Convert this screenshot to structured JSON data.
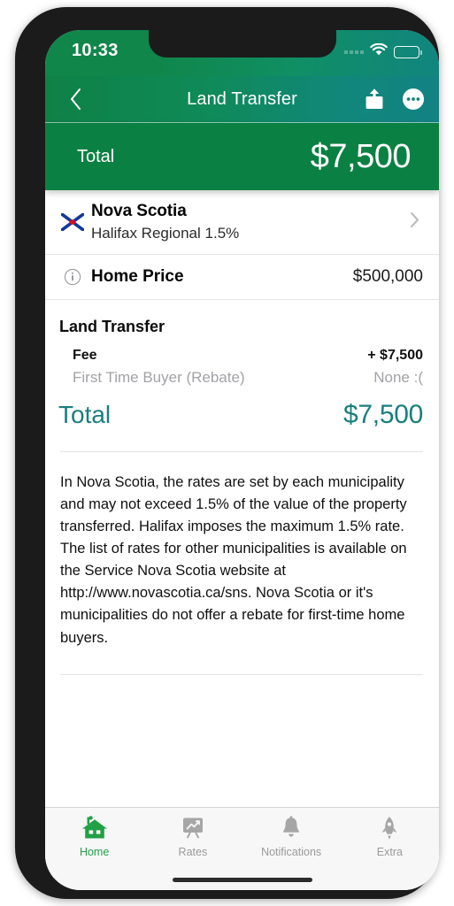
{
  "status_bar": {
    "time": "10:33",
    "wifi_icon": "wifi-icon",
    "battery_icon": "battery-full-icon"
  },
  "nav_bar": {
    "title": "Land Transfer",
    "back_icon": "chevron-left-icon",
    "share_icon": "share-icon",
    "more_icon": "more-circle-icon"
  },
  "total_banner": {
    "label": "Total",
    "value": "$7,500"
  },
  "region_row": {
    "flag_icon": "nova-scotia-flag-icon",
    "name": "Nova Scotia",
    "subtitle": "Halifax Regional 1.5%",
    "chevron_icon": "chevron-right-icon"
  },
  "home_price_row": {
    "info_icon": "info-circle-icon",
    "label": "Home Price",
    "value": "$500,000"
  },
  "land_transfer": {
    "section_title": "Land Transfer",
    "items": [
      {
        "label": "Fee",
        "value": "+ $7,500",
        "muted": false
      },
      {
        "label": "First Time Buyer (Rebate)",
        "value": "None :(",
        "muted": true
      }
    ],
    "total_label": "Total",
    "total_value": "$7,500"
  },
  "description": "In Nova Scotia, the rates are set by each municipality and may not exceed 1.5% of the value of the property transferred. Halifax imposes the maximum 1.5% rate. The list of rates for other municipalities is available on the Service Nova Scotia website at http://www.novascotia.ca/sns. Nova Scotia or it's municipalities do not offer a rebate for first-time home buyers.",
  "tab_bar": {
    "items": [
      {
        "label": "Home",
        "icon": "house-icon",
        "active": true
      },
      {
        "label": "Rates",
        "icon": "chart-board-icon",
        "active": false
      },
      {
        "label": "Notifications",
        "icon": "bell-icon",
        "active": false
      },
      {
        "label": "Extra",
        "icon": "rocket-icon",
        "active": false
      }
    ]
  },
  "colors": {
    "brand_green": "#0b8043",
    "brand_teal": "#1a7e7e",
    "tab_active": "#21a047",
    "muted_text": "#a2a2a7"
  }
}
